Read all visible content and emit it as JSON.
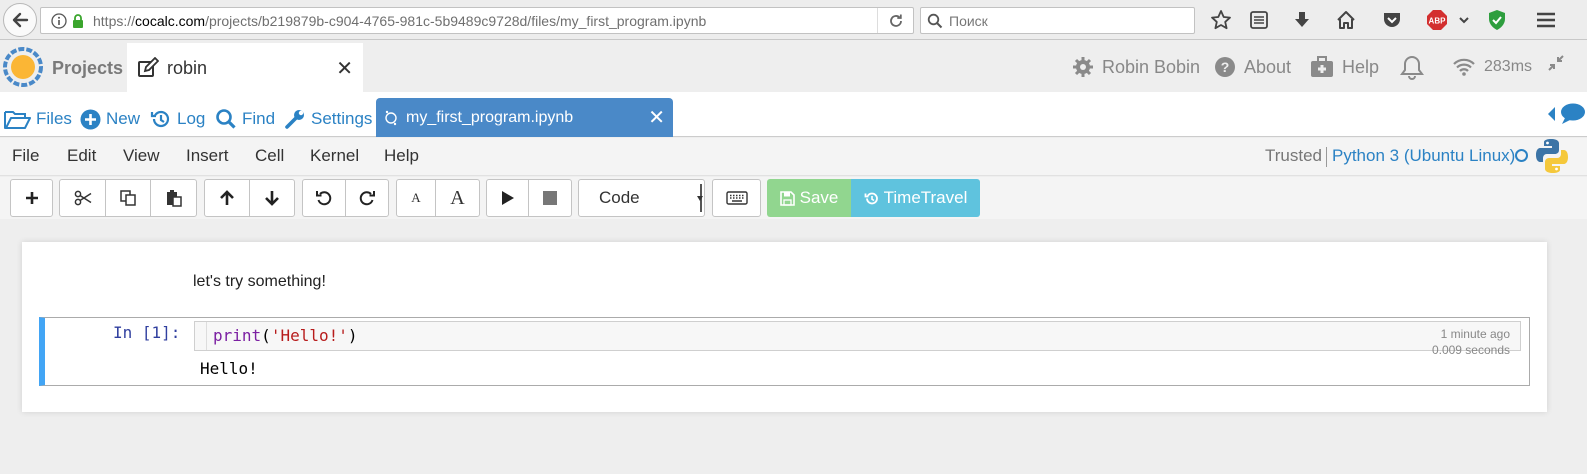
{
  "browser": {
    "url_prefix": "https://",
    "url_domain": "cocalc.com",
    "url_path": "/projects/b219879b-c904-4765-981c-5b9489c9728d/files/my_first_program.ipynb",
    "search_placeholder": "Поиск",
    "abp_label": "ABP"
  },
  "topnav": {
    "projects_label": "Projects",
    "project_tab": "robin",
    "close_glyph": "✕",
    "user": "Robin Bobin",
    "about": "About",
    "help": "Help",
    "ping": "283ms"
  },
  "filenav": {
    "files": "Files",
    "new": "New",
    "log": "Log",
    "find": "Find",
    "settings": "Settings",
    "open_file": "my_first_program.ipynb",
    "close_glyph": "✕"
  },
  "menubar": {
    "items": [
      "File",
      "Edit",
      "View",
      "Insert",
      "Cell",
      "Kernel",
      "Help"
    ],
    "trusted": "Trusted",
    "kernel": "Python 3 (Ubuntu Linux)"
  },
  "toolbar": {
    "cell_type": "Code",
    "save": "Save",
    "timetravel": "TimeTravel",
    "font_small": "A",
    "font_large": "A"
  },
  "notebook": {
    "markdown": "let's try something!",
    "cell": {
      "prompt": "In [1]:",
      "code_fn": "print",
      "code_open": "(",
      "code_str": "'Hello!'",
      "code_close": ")",
      "time_ago": "1 minute ago",
      "duration": "0.009 seconds",
      "output": "Hello!"
    }
  },
  "colors": {
    "accent_blue": "#4a89c8",
    "link_blue": "#2b82c4",
    "save_green": "#91d68f",
    "timetravel_cyan": "#5fc3de",
    "cell_border": "#42a5f5"
  }
}
